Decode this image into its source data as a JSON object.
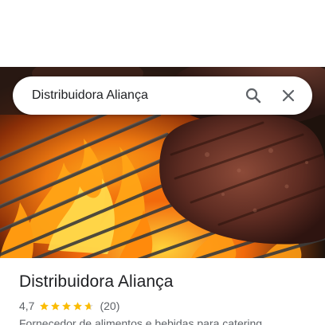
{
  "search": {
    "query": "Distribuidora Aliança",
    "search_icon": "search-icon",
    "clear_icon": "close-icon"
  },
  "place": {
    "hero_image": "grilled-steak-on-flaming-grill",
    "name": "Distribuidora Aliança",
    "rating": "4,7",
    "rating_value": 4.7,
    "stars_max": 5,
    "reviews": "(20)",
    "category": "Fornecedor de alimentos e bebidas para catering"
  },
  "colors": {
    "star": "#fbbc04",
    "star_empty": "#dadce0",
    "text_primary": "#202124",
    "text_secondary": "#5f6368",
    "icon": "#5f6368"
  }
}
